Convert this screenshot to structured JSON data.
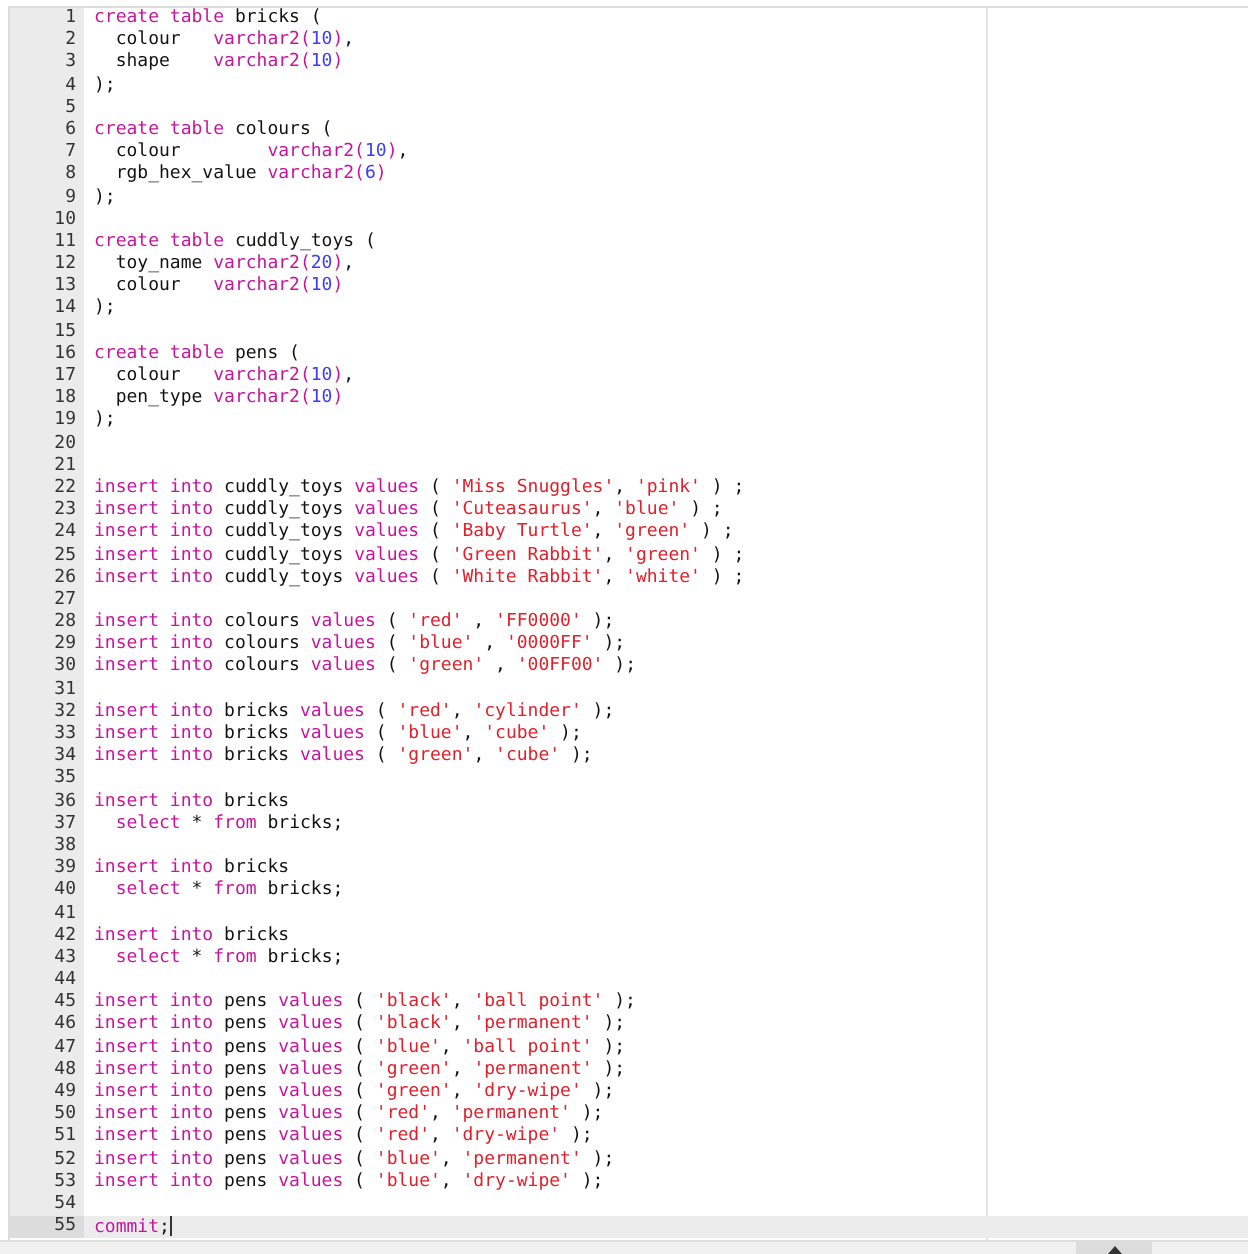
{
  "editor": {
    "lines": [
      {
        "number": "1",
        "active": false,
        "tokens": [
          {
            "kind": "keyword",
            "text": "create table"
          },
          {
            "kind": "plain",
            "text": " bricks ("
          }
        ]
      },
      {
        "number": "2",
        "active": false,
        "tokens": [
          {
            "kind": "plain",
            "text": "  colour   "
          },
          {
            "kind": "keyword",
            "text": "varchar2("
          },
          {
            "kind": "number",
            "text": "10"
          },
          {
            "kind": "keyword",
            "text": ")"
          },
          {
            "kind": "plain",
            "text": ","
          }
        ]
      },
      {
        "number": "3",
        "active": false,
        "tokens": [
          {
            "kind": "plain",
            "text": "  shape    "
          },
          {
            "kind": "keyword",
            "text": "varchar2("
          },
          {
            "kind": "number",
            "text": "10"
          },
          {
            "kind": "keyword",
            "text": ")"
          }
        ]
      },
      {
        "number": "4",
        "active": false,
        "tokens": [
          {
            "kind": "plain",
            "text": ");"
          }
        ]
      },
      {
        "number": "5",
        "active": false
      },
      {
        "number": "6",
        "active": false,
        "tokens": [
          {
            "kind": "keyword",
            "text": "create table"
          },
          {
            "kind": "plain",
            "text": " colours ("
          }
        ]
      },
      {
        "number": "7",
        "active": false,
        "tokens": [
          {
            "kind": "plain",
            "text": "  colour        "
          },
          {
            "kind": "keyword",
            "text": "varchar2("
          },
          {
            "kind": "number",
            "text": "10"
          },
          {
            "kind": "keyword",
            "text": ")"
          },
          {
            "kind": "plain",
            "text": ","
          }
        ]
      },
      {
        "number": "8",
        "active": false,
        "tokens": [
          {
            "kind": "plain",
            "text": "  rgb_hex_value "
          },
          {
            "kind": "keyword",
            "text": "varchar2("
          },
          {
            "kind": "number",
            "text": "6"
          },
          {
            "kind": "keyword",
            "text": ")"
          }
        ]
      },
      {
        "number": "9",
        "active": false,
        "tokens": [
          {
            "kind": "plain",
            "text": ");"
          }
        ]
      },
      {
        "number": "10",
        "active": false
      },
      {
        "number": "11",
        "active": false,
        "tokens": [
          {
            "kind": "keyword",
            "text": "create table"
          },
          {
            "kind": "plain",
            "text": " cuddly_toys ("
          }
        ]
      },
      {
        "number": "12",
        "active": false,
        "tokens": [
          {
            "kind": "plain",
            "text": "  toy_name "
          },
          {
            "kind": "keyword",
            "text": "varchar2("
          },
          {
            "kind": "number",
            "text": "20"
          },
          {
            "kind": "keyword",
            "text": ")"
          },
          {
            "kind": "plain",
            "text": ","
          }
        ]
      },
      {
        "number": "13",
        "active": false,
        "tokens": [
          {
            "kind": "plain",
            "text": "  colour   "
          },
          {
            "kind": "keyword",
            "text": "varchar2("
          },
          {
            "kind": "number",
            "text": "10"
          },
          {
            "kind": "keyword",
            "text": ")"
          }
        ]
      },
      {
        "number": "14",
        "active": false,
        "tokens": [
          {
            "kind": "plain",
            "text": ");"
          }
        ]
      },
      {
        "number": "15",
        "active": false
      },
      {
        "number": "16",
        "active": false,
        "tokens": [
          {
            "kind": "keyword",
            "text": "create table"
          },
          {
            "kind": "plain",
            "text": " pens ("
          }
        ]
      },
      {
        "number": "17",
        "active": false,
        "tokens": [
          {
            "kind": "plain",
            "text": "  colour   "
          },
          {
            "kind": "keyword",
            "text": "varchar2("
          },
          {
            "kind": "number",
            "text": "10"
          },
          {
            "kind": "keyword",
            "text": ")"
          },
          {
            "kind": "plain",
            "text": ","
          }
        ]
      },
      {
        "number": "18",
        "active": false,
        "tokens": [
          {
            "kind": "plain",
            "text": "  pen_type "
          },
          {
            "kind": "keyword",
            "text": "varchar2("
          },
          {
            "kind": "number",
            "text": "10"
          },
          {
            "kind": "keyword",
            "text": ")"
          }
        ]
      },
      {
        "number": "19",
        "active": false,
        "tokens": [
          {
            "kind": "plain",
            "text": ");"
          }
        ]
      },
      {
        "number": "20",
        "active": false
      },
      {
        "number": "21",
        "active": false
      },
      {
        "number": "22",
        "active": false,
        "tokens": [
          {
            "kind": "keyword",
            "text": "insert into"
          },
          {
            "kind": "plain",
            "text": " cuddly_toys "
          },
          {
            "kind": "keyword",
            "text": "values"
          },
          {
            "kind": "plain",
            "text": " ( "
          },
          {
            "kind": "string",
            "text": "'Miss Snuggles'"
          },
          {
            "kind": "plain",
            "text": ", "
          },
          {
            "kind": "string",
            "text": "'pink'"
          },
          {
            "kind": "plain",
            "text": " ) ;"
          }
        ]
      },
      {
        "number": "23",
        "active": false,
        "tokens": [
          {
            "kind": "keyword",
            "text": "insert into"
          },
          {
            "kind": "plain",
            "text": " cuddly_toys "
          },
          {
            "kind": "keyword",
            "text": "values"
          },
          {
            "kind": "plain",
            "text": " ( "
          },
          {
            "kind": "string",
            "text": "'Cuteasaurus'"
          },
          {
            "kind": "plain",
            "text": ", "
          },
          {
            "kind": "string",
            "text": "'blue'"
          },
          {
            "kind": "plain",
            "text": " ) ;"
          }
        ]
      },
      {
        "number": "24",
        "active": false,
        "tokens": [
          {
            "kind": "keyword",
            "text": "insert into"
          },
          {
            "kind": "plain",
            "text": " cuddly_toys "
          },
          {
            "kind": "keyword",
            "text": "values"
          },
          {
            "kind": "plain",
            "text": " ( "
          },
          {
            "kind": "string",
            "text": "'Baby Turtle'"
          },
          {
            "kind": "plain",
            "text": ", "
          },
          {
            "kind": "string",
            "text": "'green'"
          },
          {
            "kind": "plain",
            "text": " ) ;"
          }
        ]
      },
      {
        "number": "25",
        "active": false,
        "tokens": [
          {
            "kind": "keyword",
            "text": "insert into"
          },
          {
            "kind": "plain",
            "text": " cuddly_toys "
          },
          {
            "kind": "keyword",
            "text": "values"
          },
          {
            "kind": "plain",
            "text": " ( "
          },
          {
            "kind": "string",
            "text": "'Green Rabbit'"
          },
          {
            "kind": "plain",
            "text": ", "
          },
          {
            "kind": "string",
            "text": "'green'"
          },
          {
            "kind": "plain",
            "text": " ) ;"
          }
        ]
      },
      {
        "number": "26",
        "active": false,
        "tokens": [
          {
            "kind": "keyword",
            "text": "insert into"
          },
          {
            "kind": "plain",
            "text": " cuddly_toys "
          },
          {
            "kind": "keyword",
            "text": "values"
          },
          {
            "kind": "plain",
            "text": " ( "
          },
          {
            "kind": "string",
            "text": "'White Rabbit'"
          },
          {
            "kind": "plain",
            "text": ", "
          },
          {
            "kind": "string",
            "text": "'white'"
          },
          {
            "kind": "plain",
            "text": " ) ;"
          }
        ]
      },
      {
        "number": "27",
        "active": false
      },
      {
        "number": "28",
        "active": false,
        "tokens": [
          {
            "kind": "keyword",
            "text": "insert into"
          },
          {
            "kind": "plain",
            "text": " colours "
          },
          {
            "kind": "keyword",
            "text": "values"
          },
          {
            "kind": "plain",
            "text": " ( "
          },
          {
            "kind": "string",
            "text": "'red'"
          },
          {
            "kind": "plain",
            "text": " , "
          },
          {
            "kind": "string",
            "text": "'FF0000'"
          },
          {
            "kind": "plain",
            "text": " );"
          }
        ]
      },
      {
        "number": "29",
        "active": false,
        "tokens": [
          {
            "kind": "keyword",
            "text": "insert into"
          },
          {
            "kind": "plain",
            "text": " colours "
          },
          {
            "kind": "keyword",
            "text": "values"
          },
          {
            "kind": "plain",
            "text": " ( "
          },
          {
            "kind": "string",
            "text": "'blue'"
          },
          {
            "kind": "plain",
            "text": " , "
          },
          {
            "kind": "string",
            "text": "'0000FF'"
          },
          {
            "kind": "plain",
            "text": " );"
          }
        ]
      },
      {
        "number": "30",
        "active": false,
        "tokens": [
          {
            "kind": "keyword",
            "text": "insert into"
          },
          {
            "kind": "plain",
            "text": " colours "
          },
          {
            "kind": "keyword",
            "text": "values"
          },
          {
            "kind": "plain",
            "text": " ( "
          },
          {
            "kind": "string",
            "text": "'green'"
          },
          {
            "kind": "plain",
            "text": " , "
          },
          {
            "kind": "string",
            "text": "'00FF00'"
          },
          {
            "kind": "plain",
            "text": " );"
          }
        ]
      },
      {
        "number": "31",
        "active": false
      },
      {
        "number": "32",
        "active": false,
        "tokens": [
          {
            "kind": "keyword",
            "text": "insert into"
          },
          {
            "kind": "plain",
            "text": " bricks "
          },
          {
            "kind": "keyword",
            "text": "values"
          },
          {
            "kind": "plain",
            "text": " ( "
          },
          {
            "kind": "string",
            "text": "'red'"
          },
          {
            "kind": "plain",
            "text": ", "
          },
          {
            "kind": "string",
            "text": "'cylinder'"
          },
          {
            "kind": "plain",
            "text": " );"
          }
        ]
      },
      {
        "number": "33",
        "active": false,
        "tokens": [
          {
            "kind": "keyword",
            "text": "insert into"
          },
          {
            "kind": "plain",
            "text": " bricks "
          },
          {
            "kind": "keyword",
            "text": "values"
          },
          {
            "kind": "plain",
            "text": " ( "
          },
          {
            "kind": "string",
            "text": "'blue'"
          },
          {
            "kind": "plain",
            "text": ", "
          },
          {
            "kind": "string",
            "text": "'cube'"
          },
          {
            "kind": "plain",
            "text": " );"
          }
        ]
      },
      {
        "number": "34",
        "active": false,
        "tokens": [
          {
            "kind": "keyword",
            "text": "insert into"
          },
          {
            "kind": "plain",
            "text": " bricks "
          },
          {
            "kind": "keyword",
            "text": "values"
          },
          {
            "kind": "plain",
            "text": " ( "
          },
          {
            "kind": "string",
            "text": "'green'"
          },
          {
            "kind": "plain",
            "text": ", "
          },
          {
            "kind": "string",
            "text": "'cube'"
          },
          {
            "kind": "plain",
            "text": " );"
          }
        ]
      },
      {
        "number": "35",
        "active": false
      },
      {
        "number": "36",
        "active": false,
        "tokens": [
          {
            "kind": "keyword",
            "text": "insert into"
          },
          {
            "kind": "plain",
            "text": " bricks"
          }
        ]
      },
      {
        "number": "37",
        "active": false,
        "tokens": [
          {
            "kind": "keyword",
            "text": "  select"
          },
          {
            "kind": "plain",
            "text": " * "
          },
          {
            "kind": "keyword",
            "text": "from"
          },
          {
            "kind": "plain",
            "text": " bricks;"
          }
        ]
      },
      {
        "number": "38",
        "active": false
      },
      {
        "number": "39",
        "active": false,
        "tokens": [
          {
            "kind": "keyword",
            "text": "insert into"
          },
          {
            "kind": "plain",
            "text": " bricks"
          }
        ]
      },
      {
        "number": "40",
        "active": false,
        "tokens": [
          {
            "kind": "keyword",
            "text": "  select"
          },
          {
            "kind": "plain",
            "text": " * "
          },
          {
            "kind": "keyword",
            "text": "from"
          },
          {
            "kind": "plain",
            "text": " bricks;"
          }
        ]
      },
      {
        "number": "41",
        "active": false
      },
      {
        "number": "42",
        "active": false,
        "tokens": [
          {
            "kind": "keyword",
            "text": "insert into"
          },
          {
            "kind": "plain",
            "text": " bricks"
          }
        ]
      },
      {
        "number": "43",
        "active": false,
        "tokens": [
          {
            "kind": "keyword",
            "text": "  select"
          },
          {
            "kind": "plain",
            "text": " * "
          },
          {
            "kind": "keyword",
            "text": "from"
          },
          {
            "kind": "plain",
            "text": " bricks;"
          }
        ]
      },
      {
        "number": "44",
        "active": false
      },
      {
        "number": "45",
        "active": false,
        "tokens": [
          {
            "kind": "keyword",
            "text": "insert into"
          },
          {
            "kind": "plain",
            "text": " pens "
          },
          {
            "kind": "keyword",
            "text": "values"
          },
          {
            "kind": "plain",
            "text": " ( "
          },
          {
            "kind": "string",
            "text": "'black'"
          },
          {
            "kind": "plain",
            "text": ", "
          },
          {
            "kind": "string",
            "text": "'ball point'"
          },
          {
            "kind": "plain",
            "text": " );"
          }
        ]
      },
      {
        "number": "46",
        "active": false,
        "tokens": [
          {
            "kind": "keyword",
            "text": "insert into"
          },
          {
            "kind": "plain",
            "text": " pens "
          },
          {
            "kind": "keyword",
            "text": "values"
          },
          {
            "kind": "plain",
            "text": " ( "
          },
          {
            "kind": "string",
            "text": "'black'"
          },
          {
            "kind": "plain",
            "text": ", "
          },
          {
            "kind": "string",
            "text": "'permanent'"
          },
          {
            "kind": "plain",
            "text": " );"
          }
        ]
      },
      {
        "number": "47",
        "active": false,
        "tokens": [
          {
            "kind": "keyword",
            "text": "insert into"
          },
          {
            "kind": "plain",
            "text": " pens "
          },
          {
            "kind": "keyword",
            "text": "values"
          },
          {
            "kind": "plain",
            "text": " ( "
          },
          {
            "kind": "string",
            "text": "'blue'"
          },
          {
            "kind": "plain",
            "text": ", "
          },
          {
            "kind": "string",
            "text": "'ball point'"
          },
          {
            "kind": "plain",
            "text": " );"
          }
        ]
      },
      {
        "number": "48",
        "active": false,
        "tokens": [
          {
            "kind": "keyword",
            "text": "insert into"
          },
          {
            "kind": "plain",
            "text": " pens "
          },
          {
            "kind": "keyword",
            "text": "values"
          },
          {
            "kind": "plain",
            "text": " ( "
          },
          {
            "kind": "string",
            "text": "'green'"
          },
          {
            "kind": "plain",
            "text": ", "
          },
          {
            "kind": "string",
            "text": "'permanent'"
          },
          {
            "kind": "plain",
            "text": " );"
          }
        ]
      },
      {
        "number": "49",
        "active": false,
        "tokens": [
          {
            "kind": "keyword",
            "text": "insert into"
          },
          {
            "kind": "plain",
            "text": " pens "
          },
          {
            "kind": "keyword",
            "text": "values"
          },
          {
            "kind": "plain",
            "text": " ( "
          },
          {
            "kind": "string",
            "text": "'green'"
          },
          {
            "kind": "plain",
            "text": ", "
          },
          {
            "kind": "string",
            "text": "'dry-wipe'"
          },
          {
            "kind": "plain",
            "text": " );"
          }
        ]
      },
      {
        "number": "50",
        "active": false,
        "tokens": [
          {
            "kind": "keyword",
            "text": "insert into"
          },
          {
            "kind": "plain",
            "text": " pens "
          },
          {
            "kind": "keyword",
            "text": "values"
          },
          {
            "kind": "plain",
            "text": " ( "
          },
          {
            "kind": "string",
            "text": "'red'"
          },
          {
            "kind": "plain",
            "text": ", "
          },
          {
            "kind": "string",
            "text": "'permanent'"
          },
          {
            "kind": "plain",
            "text": " );"
          }
        ]
      },
      {
        "number": "51",
        "active": false,
        "tokens": [
          {
            "kind": "keyword",
            "text": "insert into"
          },
          {
            "kind": "plain",
            "text": " pens "
          },
          {
            "kind": "keyword",
            "text": "values"
          },
          {
            "kind": "plain",
            "text": " ( "
          },
          {
            "kind": "string",
            "text": "'red'"
          },
          {
            "kind": "plain",
            "text": ", "
          },
          {
            "kind": "string",
            "text": "'dry-wipe'"
          },
          {
            "kind": "plain",
            "text": " );"
          }
        ]
      },
      {
        "number": "52",
        "active": false,
        "tokens": [
          {
            "kind": "keyword",
            "text": "insert into"
          },
          {
            "kind": "plain",
            "text": " pens "
          },
          {
            "kind": "keyword",
            "text": "values"
          },
          {
            "kind": "plain",
            "text": " ( "
          },
          {
            "kind": "string",
            "text": "'blue'"
          },
          {
            "kind": "plain",
            "text": ", "
          },
          {
            "kind": "string",
            "text": "'permanent'"
          },
          {
            "kind": "plain",
            "text": " );"
          }
        ]
      },
      {
        "number": "53",
        "active": false,
        "tokens": [
          {
            "kind": "keyword",
            "text": "insert into"
          },
          {
            "kind": "plain",
            "text": " pens "
          },
          {
            "kind": "keyword",
            "text": "values"
          },
          {
            "kind": "plain",
            "text": " ( "
          },
          {
            "kind": "string",
            "text": "'blue'"
          },
          {
            "kind": "plain",
            "text": ", "
          },
          {
            "kind": "string",
            "text": "'dry-wipe'"
          },
          {
            "kind": "plain",
            "text": " );"
          }
        ]
      },
      {
        "number": "54",
        "active": false
      },
      {
        "number": "55",
        "active": true,
        "tokens": [
          {
            "kind": "keyword",
            "text": "commit"
          },
          {
            "kind": "plain",
            "text": ";"
          }
        ]
      }
    ]
  }
}
